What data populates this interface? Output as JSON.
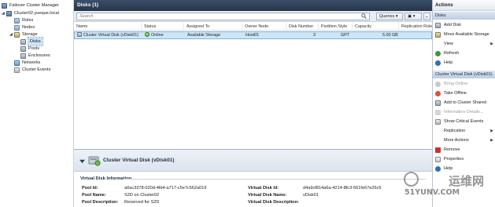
{
  "tree": {
    "root": "Failover Cluster Manager",
    "cluster": "Cluster02.yueque.local",
    "roles": "Roles",
    "nodes": "Nodes",
    "storage": "Storage",
    "disks": "Disks",
    "pools": "Pools",
    "enclosures": "Enclosures",
    "networks": "Networks",
    "cluster_events": "Cluster Events"
  },
  "pane": {
    "title": "Disks (1)",
    "search_placeholder": "Search",
    "queries_label": "Queries",
    "columns": [
      "Name",
      "Status",
      "Assigned To",
      "Owner Node",
      "Disk Number",
      "Partition Style",
      "Capacity",
      "Replication Role"
    ],
    "row": {
      "name": "Cluster Virtual Disk (vDisk01)",
      "status": "Online",
      "assigned_to": "Available Storage",
      "owner_node": "Host01",
      "disk_number": "3",
      "partition_style": "GPT",
      "capacity": "5.00 GB"
    }
  },
  "details": {
    "title": "Cluster Virtual Disk (vDisk01)",
    "section": "Virtual Disk Information",
    "pool_id_label": "Pool Id:",
    "pool_id": "a0ac3378-020d-4fd4-a717-c5e7c562a019",
    "pool_name_label": "Pool Name:",
    "pool_name": "S2D on Cluster02",
    "pool_desc_label": "Pool Description:",
    "pool_desc": "Reserved for S2D",
    "vdisk_id_label": "Virtual Disk Id:",
    "vdisk_id": "d4a9cf814a6a-4214-8fc3-561fe67e26c5",
    "vdisk_name_label": "Virtual Disk Name:",
    "vdisk_name": "vDisk01",
    "vdisk_desc_label": "Virtual Disk Description:"
  },
  "actions": {
    "title": "Actions",
    "section_disks": "Disks",
    "add_disk": "Add Disk",
    "move_available_storage": "Move Available Storage",
    "view": "View",
    "refresh": "Refresh",
    "help": "Help",
    "section_vdisk": "Cluster Virtual Disk (vDisk01)",
    "bring_online": "Bring Online",
    "take_offline": "Take Offline",
    "add_to_csv": "Add to Cluster Shared",
    "information_details": "Information Details...",
    "show_critical_events": "Show Critical Events",
    "replication": "Replication",
    "more_actions": "More Actions",
    "remove": "Remove",
    "properties": "Properties",
    "help2": "Help"
  },
  "watermark": {
    "big": "运维网",
    "small": "51YUNV.COM"
  }
}
